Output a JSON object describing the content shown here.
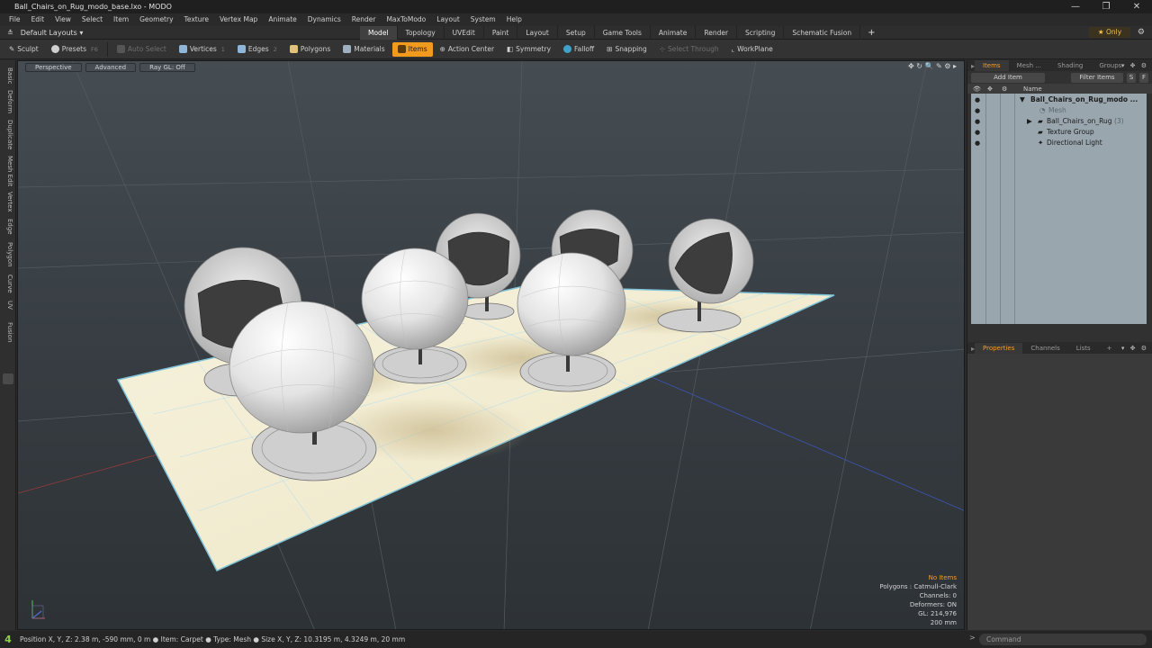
{
  "window": {
    "title": "Ball_Chairs_on_Rug_modo_base.lxo - MODO",
    "minimize": "—",
    "maximize": "❐",
    "close": "✕"
  },
  "menu": [
    "File",
    "Edit",
    "View",
    "Select",
    "Item",
    "Geometry",
    "Texture",
    "Vertex Map",
    "Animate",
    "Dynamics",
    "Render",
    "MaxToModo",
    "Layout",
    "System",
    "Help"
  ],
  "layouts": {
    "label": "Default Layouts ▾"
  },
  "tabs": [
    "Model",
    "Topology",
    "UVEdit",
    "Paint",
    "Layout",
    "Setup",
    "Game Tools",
    "Animate",
    "Render",
    "Scripting",
    "Schematic Fusion"
  ],
  "active_tab": "Model",
  "only_label": "★  Only",
  "toolbar": {
    "sculpt": "Sculpt",
    "presets": "Presets",
    "presets_key": "F6",
    "auto_select": "Auto Select",
    "vertices": "Vertices",
    "vertices_key": "1",
    "edges": "Edges",
    "edges_key": "2",
    "polygons": "Polygons",
    "materials": "Materials",
    "items": "Items",
    "action_center": "Action Center",
    "symmetry": "Symmetry",
    "falloff": "Falloff",
    "snapping": "Snapping",
    "select_through": "Select Through",
    "workplane": "WorkPlane"
  },
  "left_tabs": [
    "Basic",
    "Deform",
    "Duplicate",
    "Mesh Edit",
    "Vertex",
    "Edge",
    "Polygon",
    "Curve",
    "UV",
    "Fusion"
  ],
  "viewport": {
    "view_mode": "Perspective",
    "shading": "Advanced",
    "raygl": "Ray GL: Off",
    "icons": "✥ ↻ 🔍 ✎ ⚙ ▸",
    "stats": {
      "no_items": "No Items",
      "polygons": "Polygons : Catmull-Clark",
      "channels": "Channels: 0",
      "deformers": "Deformers: ON",
      "gl": "GL: 214,976",
      "grid": "200 mm"
    }
  },
  "items_panel": {
    "tabs": [
      "Items",
      "Mesh ...",
      "Shading",
      "Groups"
    ],
    "active_tab": "Items",
    "add_item": "Add Item",
    "filter_items": "Filter Items",
    "s_btn": "S",
    "f_btn": "F",
    "name_header": "Name",
    "tree": [
      {
        "label": "Ball_Chairs_on_Rug_modo ...",
        "expander": "▼"
      },
      {
        "label": "Mesh"
      },
      {
        "label": "Ball_Chairs_on_Rug",
        "count": "(3)",
        "expander": "▶"
      },
      {
        "label": "Texture Group"
      },
      {
        "label": "Directional Light"
      }
    ]
  },
  "props_panel": {
    "tabs": [
      "Properties",
      "Channels",
      "Lists"
    ],
    "active_tab": "Properties"
  },
  "status": {
    "badge": "4",
    "readout": "Position X, Y, Z:   2.38 m, -590 mm, 0 m ● Item:  Carpet ● Type:  Mesh ● Size X, Y, Z:   10.3195 m, 4.3249 m, 20 mm",
    "command_placeholder": "Command",
    "command_arrow": ">"
  }
}
